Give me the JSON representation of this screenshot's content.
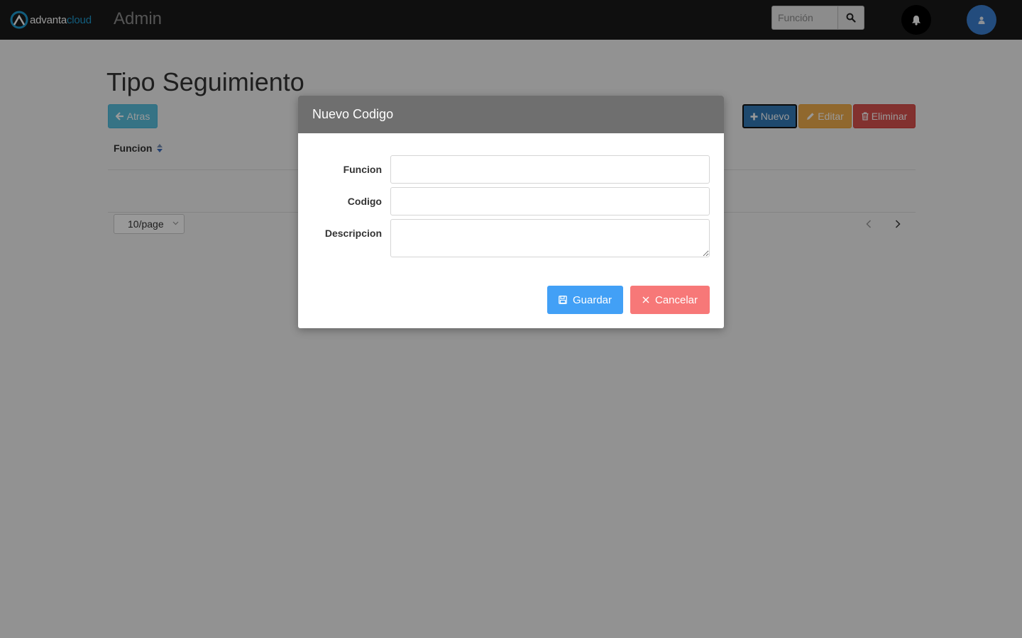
{
  "header": {
    "logo_part1": "advanta",
    "logo_part2": "cloud",
    "app_title": "Admin",
    "search_placeholder": "Función",
    "brand_color": "#1f9bd1"
  },
  "page": {
    "title": "Tipo Seguimiento",
    "buttons": {
      "back": "Atras",
      "new": "Nuevo",
      "edit": "Editar",
      "delete": "Eliminar"
    },
    "table": {
      "columns": [
        "Funcion"
      ]
    },
    "page_size": "10/page"
  },
  "modal": {
    "title": "Nuevo Codigo",
    "fields": [
      {
        "label": "Funcion",
        "value": ""
      },
      {
        "label": "Codigo",
        "value": ""
      },
      {
        "label": "Descripcion",
        "value": ""
      }
    ],
    "save_label": "Guardar",
    "cancel_label": "Cancelar",
    "save_color": "#42a0f6",
    "cancel_color": "#f77878"
  }
}
